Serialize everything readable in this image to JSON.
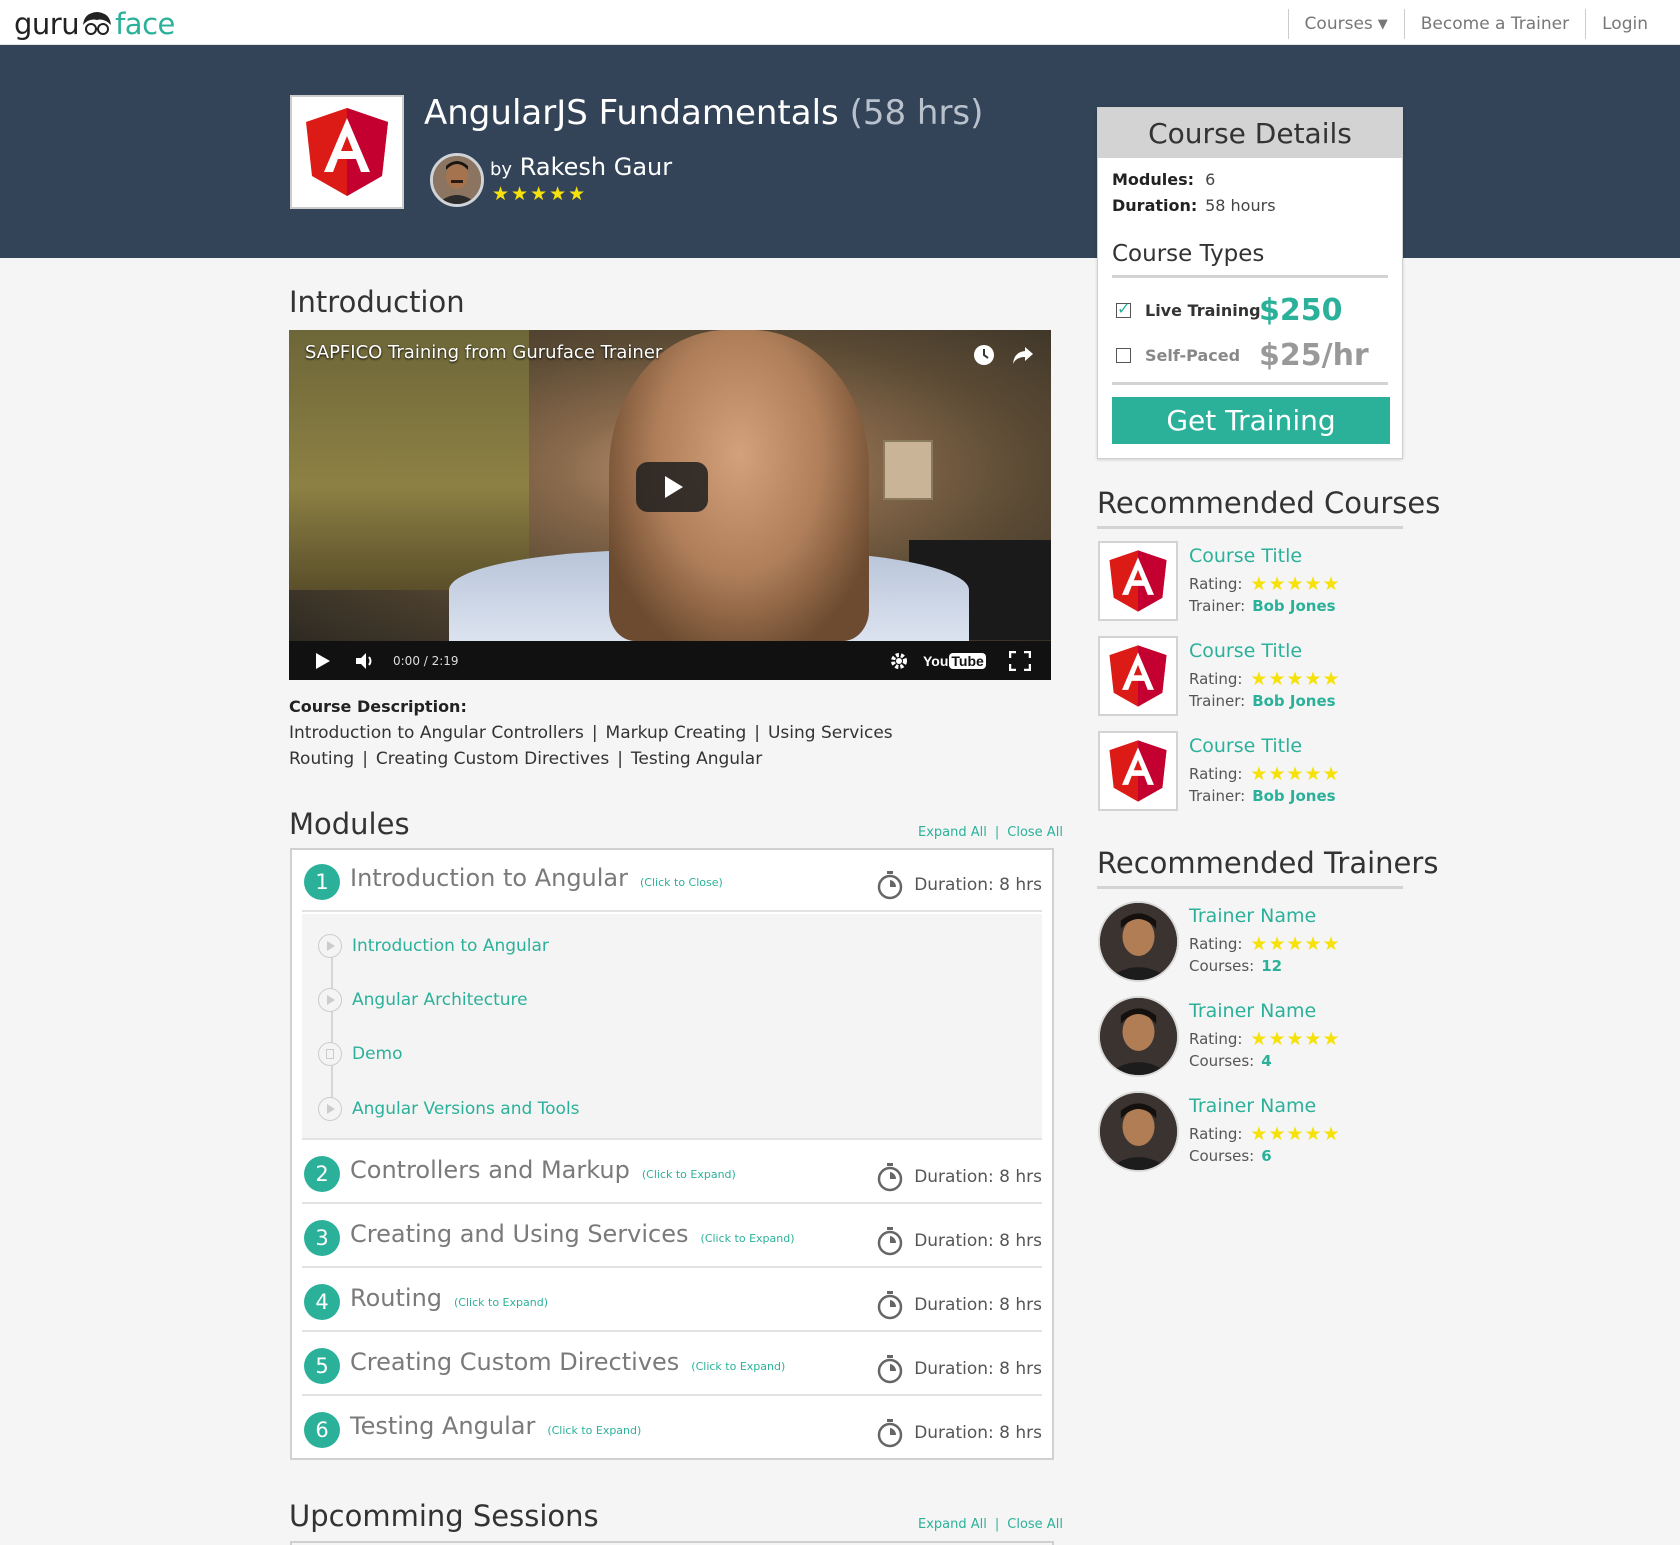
{
  "nav": {
    "logo_guru": "guru",
    "logo_face": "face",
    "courses": "Courses",
    "become_trainer": "Become a Trainer",
    "login": "Login"
  },
  "course": {
    "title": "AngularJS Fundamentals",
    "hours": "(58 hrs)",
    "by": "by",
    "trainer": "Rakesh Gaur",
    "stars": "★★★★★",
    "rating": 5
  },
  "details": {
    "heading": "Course Details",
    "modules_label": "Modules:",
    "modules_value": "6",
    "duration_label": "Duration:",
    "duration_value": "58 hours",
    "types_heading": "Course Types",
    "types": [
      {
        "label": "Live Training",
        "price": "$250",
        "checked": true,
        "color": "#2bb19a"
      },
      {
        "label": "Self-Paced",
        "price": "$25/hr",
        "checked": false,
        "color": "#999999"
      }
    ],
    "cta": "Get Training"
  },
  "intro": {
    "heading": "Introduction",
    "video_title": "SAPFICO Training from Guruface Trainer",
    "time": "0:00 / 2:19",
    "youtube_a": "You",
    "youtube_b": "Tube",
    "description_label": "Course Description:",
    "description_items": [
      "Introduction to Angular Controllers",
      "Markup Creating",
      "Using Services Routing",
      "Creating Custom Directives",
      "Testing Angular"
    ],
    "separator": "|"
  },
  "modules": {
    "heading": "Modules",
    "expand_all": "Expand All",
    "close_all": "Close All",
    "items": [
      {
        "num": "1",
        "title": "Introduction to Angular",
        "hint": "(Click to Close)",
        "duration": "Duration: 8 hrs"
      },
      {
        "num": "2",
        "title": "Controllers and Markup",
        "hint": "(Click to Expand)",
        "duration": "Duration: 8 hrs"
      },
      {
        "num": "3",
        "title": "Creating and Using Services",
        "hint": "(Click to Expand)",
        "duration": "Duration: 8 hrs"
      },
      {
        "num": "4",
        "title": "Routing",
        "hint": "(Click to Expand)",
        "duration": "Duration: 8 hrs"
      },
      {
        "num": "5",
        "title": "Creating Custom Directives",
        "hint": "(Click to Expand)",
        "duration": "Duration: 8 hrs"
      },
      {
        "num": "6",
        "title": "Testing Angular",
        "hint": "(Click to Expand)",
        "duration": "Duration: 8 hrs"
      }
    ],
    "lessons": [
      {
        "label": "Introduction to Angular",
        "icon": "play-icon"
      },
      {
        "label": "Angular Architecture",
        "icon": "play-icon"
      },
      {
        "label": "Demo",
        "icon": "document-icon"
      },
      {
        "label": "Angular Versions and Tools",
        "icon": "play-icon"
      }
    ]
  },
  "upcoming": {
    "heading": "Upcomming Sessions",
    "expand_all": "Expand All",
    "close_all": "Close All"
  },
  "recommended_courses": {
    "heading": "Recommended Courses",
    "rating_label": "Rating:",
    "trainer_label": "Trainer:",
    "items": [
      {
        "title": "Course Title",
        "stars": "★★★★★",
        "trainer": "Bob Jones"
      },
      {
        "title": "Course Title",
        "stars": "★★★★★",
        "trainer": "Bob Jones"
      },
      {
        "title": "Course Title",
        "stars": "★★★★★",
        "trainer": "Bob Jones"
      }
    ]
  },
  "recommended_trainers": {
    "heading": "Recommended Trainers",
    "rating_label": "Rating:",
    "courses_label": "Courses:",
    "items": [
      {
        "name": "Trainer Name",
        "stars": "★★★★★",
        "courses": "12"
      },
      {
        "name": "Trainer Name",
        "stars": "★★★★★",
        "courses": "4"
      },
      {
        "name": "Trainer Name",
        "stars": "★★★★★",
        "courses": "6"
      }
    ]
  },
  "colors": {
    "accent": "#2bb19a",
    "hero_bg": "#344458",
    "star": "#f7e10a",
    "angular_red": "#dd1b16"
  }
}
